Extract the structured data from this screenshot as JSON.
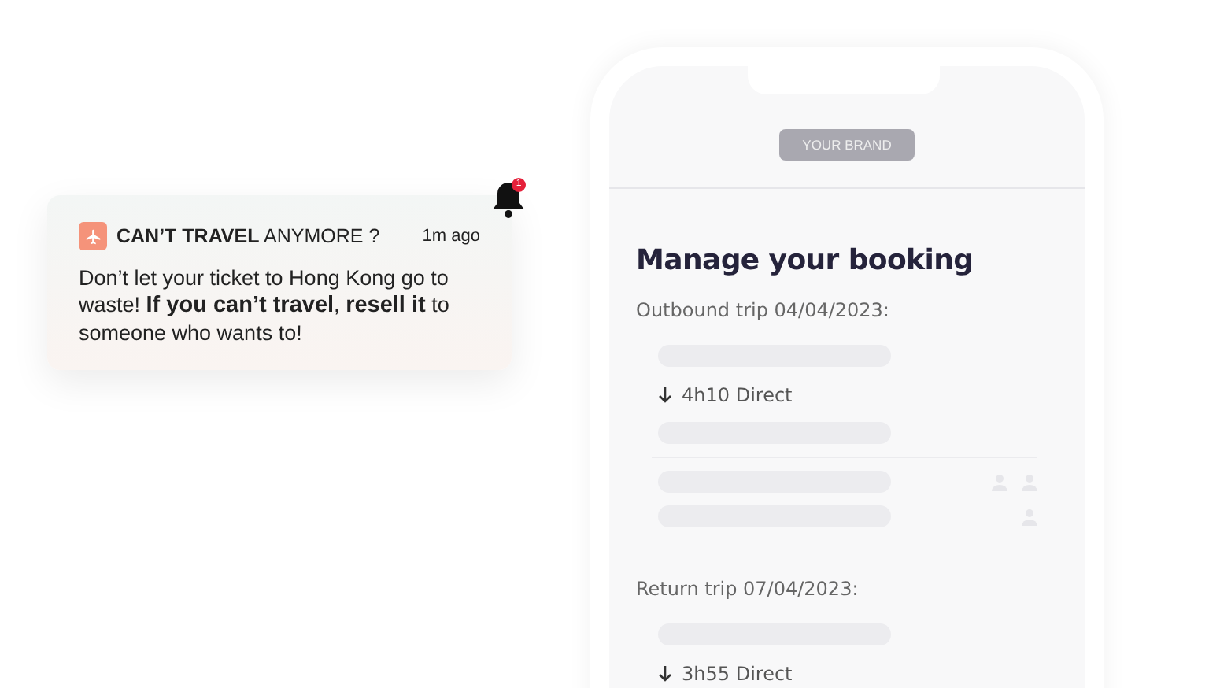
{
  "notification": {
    "title_bold": "CAN’T TRAVEL",
    "title_rest": "ANYMORE ?",
    "time": "1m ago",
    "message": "Don’t let your ticket to Hong Kong go to waste! **If you can’t travel**, **resell it** to someone who wants to!"
  },
  "bell": {
    "badge": "1"
  },
  "phone": {
    "brand": "YOUR BRAND",
    "heading": "Manage your booking",
    "trips": [
      {
        "label": "Outbound trip 04/04/2023:",
        "duration": "4h10 Direct"
      },
      {
        "label": "Return trip 07/04/2023:",
        "duration": "3h55 Direct"
      }
    ]
  }
}
